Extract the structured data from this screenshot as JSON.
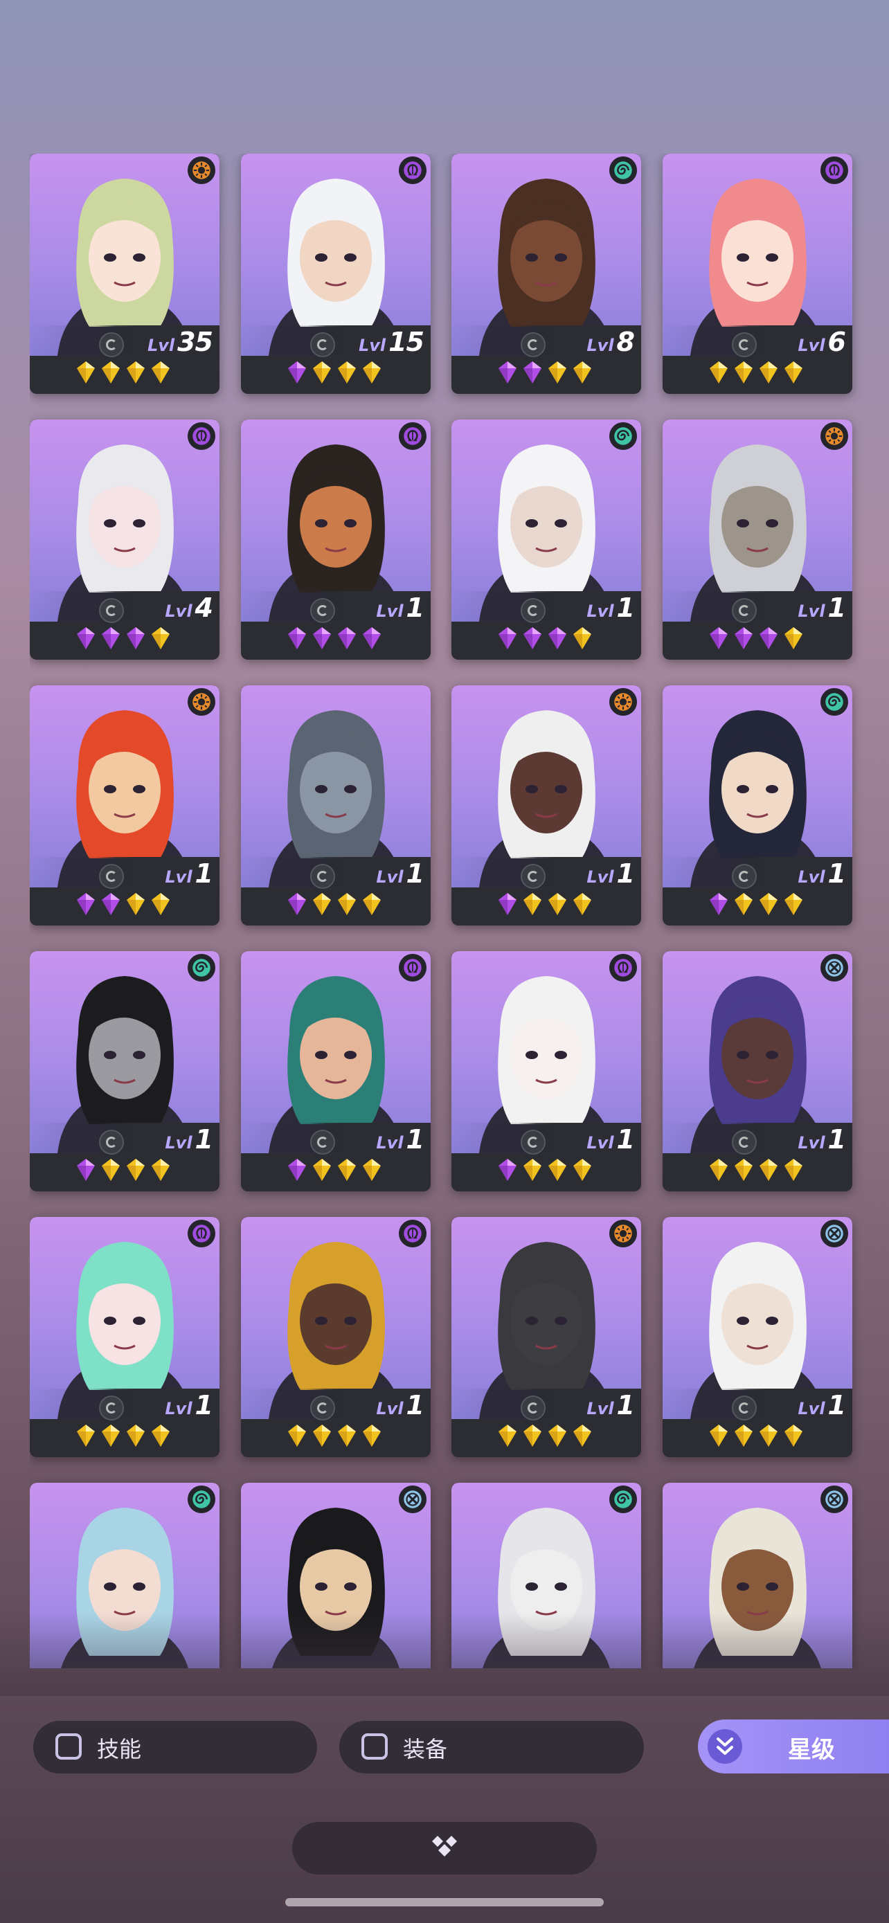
{
  "heroes": [
    {
      "level_prefix": "Lvl",
      "level": "35",
      "faction": "sun",
      "gems": [
        "gold",
        "gold",
        "gold",
        "gold"
      ]
    },
    {
      "level_prefix": "Lvl",
      "level": "15",
      "faction": "omega",
      "gems": [
        "purple",
        "gold",
        "gold",
        "gold"
      ]
    },
    {
      "level_prefix": "Lvl",
      "level": "8",
      "faction": "spiral",
      "gems": [
        "purple",
        "purple",
        "gold",
        "gold"
      ]
    },
    {
      "level_prefix": "Lvl",
      "level": "6",
      "faction": "omega",
      "gems": [
        "gold",
        "gold",
        "gold",
        "gold"
      ]
    },
    {
      "level_prefix": "Lvl",
      "level": "4",
      "faction": "omega",
      "gems": [
        "purple",
        "purple",
        "purple",
        "gold"
      ]
    },
    {
      "level_prefix": "Lvl",
      "level": "1",
      "faction": "omega",
      "gems": [
        "purple",
        "purple",
        "purple",
        "purple"
      ]
    },
    {
      "level_prefix": "Lvl",
      "level": "1",
      "faction": "spiral",
      "gems": [
        "purple",
        "purple",
        "purple",
        "gold"
      ]
    },
    {
      "level_prefix": "Lvl",
      "level": "1",
      "faction": "sun",
      "gems": [
        "purple",
        "purple",
        "purple",
        "gold"
      ]
    },
    {
      "level_prefix": "Lvl",
      "level": "1",
      "faction": "sun",
      "gems": [
        "purple",
        "purple",
        "gold",
        "gold"
      ]
    },
    {
      "level_prefix": "Lvl",
      "level": "1",
      "faction": "none",
      "gems": [
        "purple",
        "gold",
        "gold",
        "gold"
      ]
    },
    {
      "level_prefix": "Lvl",
      "level": "1",
      "faction": "sun",
      "gems": [
        "purple",
        "gold",
        "gold",
        "gold"
      ]
    },
    {
      "level_prefix": "Lvl",
      "level": "1",
      "faction": "spiral",
      "gems": [
        "purple",
        "gold",
        "gold",
        "gold"
      ]
    },
    {
      "level_prefix": "Lvl",
      "level": "1",
      "faction": "spiral",
      "gems": [
        "purple",
        "gold",
        "gold",
        "gold"
      ]
    },
    {
      "level_prefix": "Lvl",
      "level": "1",
      "faction": "omega",
      "gems": [
        "purple",
        "gold",
        "gold",
        "gold"
      ]
    },
    {
      "level_prefix": "Lvl",
      "level": "1",
      "faction": "omega",
      "gems": [
        "purple",
        "gold",
        "gold",
        "gold"
      ]
    },
    {
      "level_prefix": "Lvl",
      "level": "1",
      "faction": "cross",
      "gems": [
        "gold",
        "gold",
        "gold",
        "gold"
      ]
    },
    {
      "level_prefix": "Lvl",
      "level": "1",
      "faction": "omega",
      "gems": [
        "gold",
        "gold",
        "gold",
        "gold"
      ]
    },
    {
      "level_prefix": "Lvl",
      "level": "1",
      "faction": "omega",
      "gems": [
        "gold",
        "gold",
        "gold",
        "gold"
      ]
    },
    {
      "level_prefix": "Lvl",
      "level": "1",
      "faction": "sun",
      "gems": [
        "gold",
        "gold",
        "gold",
        "gold"
      ]
    },
    {
      "level_prefix": "Lvl",
      "level": "1",
      "faction": "cross",
      "gems": [
        "gold",
        "gold",
        "gold",
        "gold"
      ]
    },
    {
      "level_prefix": "",
      "level": "",
      "faction": "spiral",
      "gems": []
    },
    {
      "level_prefix": "",
      "level": "",
      "faction": "cross",
      "gems": []
    },
    {
      "level_prefix": "",
      "level": "",
      "faction": "spiral",
      "gems": []
    },
    {
      "level_prefix": "",
      "level": "",
      "faction": "cross",
      "gems": []
    }
  ],
  "filters": {
    "skills_label": "技能",
    "equipment_label": "装备"
  },
  "sort": {
    "label": "星级"
  },
  "colors": {
    "sun": "#e8892b",
    "omega": "#a14ce0",
    "spiral": "#3fc4a6",
    "cross": "#8ec3e8",
    "gem_purple": "#b14ee8",
    "gem_gold": "#f2c21f",
    "accent": "#9b8cf4"
  },
  "icons": {
    "sun": "sun-faction-icon",
    "omega": "omega-faction-icon",
    "spiral": "spiral-faction-icon",
    "cross": "cross-faction-icon",
    "expand": "diamond-cluster-icon",
    "sort_chevron": "double-chevron-down-icon"
  }
}
